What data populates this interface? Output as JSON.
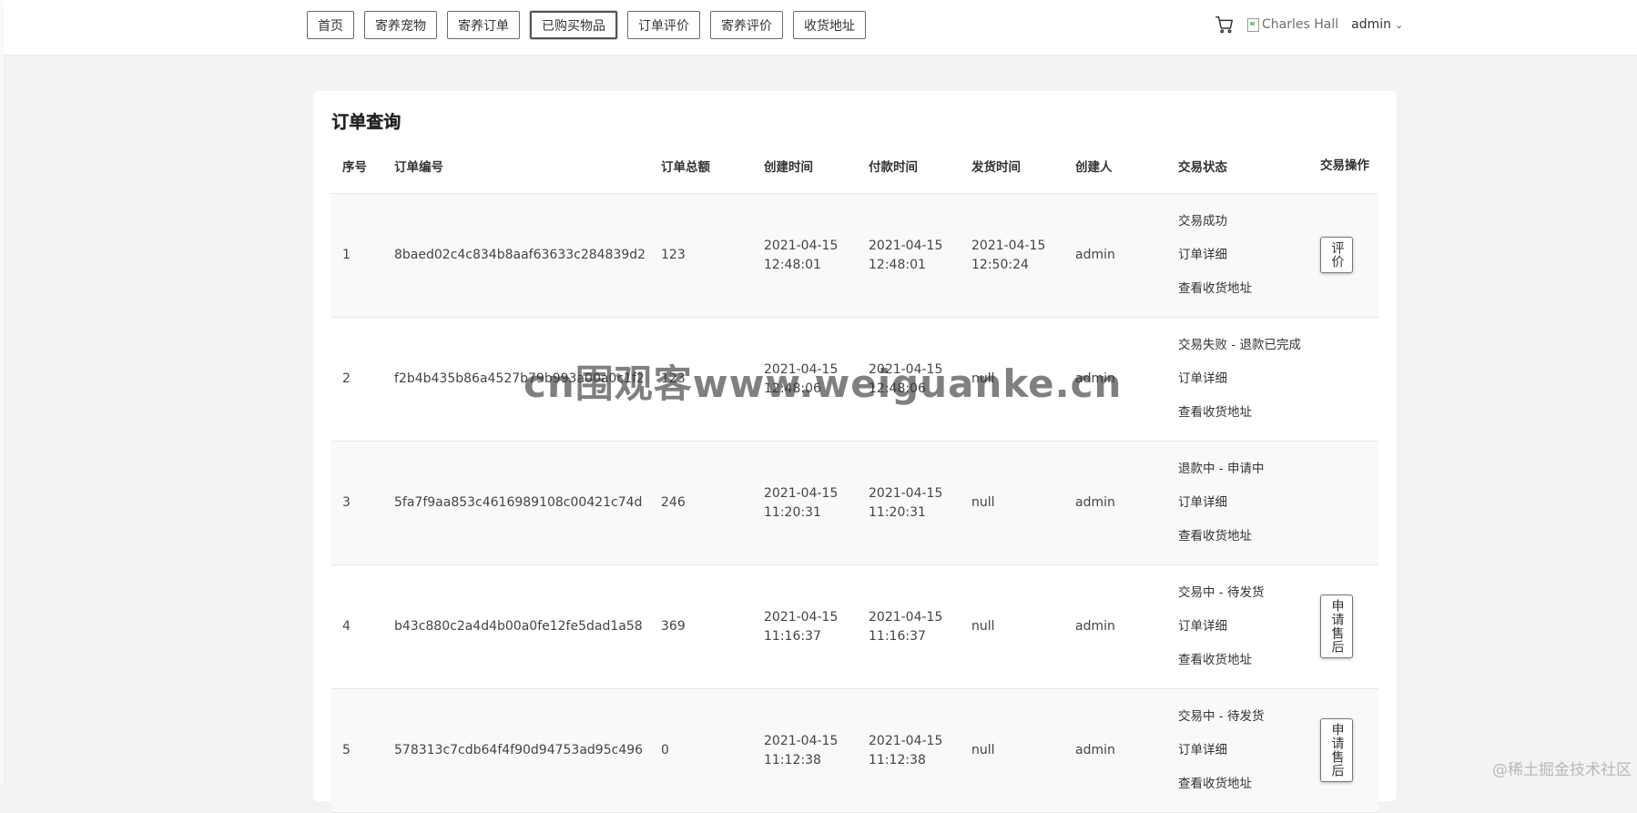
{
  "nav": {
    "items": [
      "首页",
      "寄养宠物",
      "寄养订单",
      "已购买物品",
      "订单评价",
      "寄养评价",
      "收货地址"
    ],
    "active_index": 3
  },
  "header": {
    "cart_icon": "cart-icon",
    "avatar_alt": "Charles Hall",
    "username": "admin",
    "dropdown_icon": "chevron-down-icon"
  },
  "card": {
    "title": "订单查询"
  },
  "table": {
    "headers": [
      "序号",
      "订单编号",
      "订单总额",
      "创建时间",
      "付款时间",
      "发货时间",
      "创建人",
      "交易状态",
      "交易操作"
    ],
    "rows": [
      {
        "no": "1",
        "order_id": "8baed02c4c834b8aaf63633c284839d2",
        "total": "123",
        "created": "2021-04-15 12:48:01",
        "paid": "2021-04-15 12:48:01",
        "shipped": "2021-04-15 12:50:24",
        "creator": "admin",
        "status": "交易成功",
        "detail": "订单详细",
        "address": "查看收货地址",
        "action": "评价"
      },
      {
        "no": "2",
        "order_id": "f2b4b435b86a4527b79b993a00a0c1f2",
        "total": "123",
        "created": "2021-04-15 12:48:06",
        "paid": "2021-04-15 12:48:06",
        "shipped": "null",
        "creator": "admin",
        "status": "交易失败 - 退款已完成",
        "detail": "订单详细",
        "address": "查看收货地址",
        "action": ""
      },
      {
        "no": "3",
        "order_id": "5fa7f9aa853c4616989108c00421c74d",
        "total": "246",
        "created": "2021-04-15 11:20:31",
        "paid": "2021-04-15 11:20:31",
        "shipped": "null",
        "creator": "admin",
        "status": "退款中 - 申请中",
        "detail": "订单详细",
        "address": "查看收货地址",
        "action": ""
      },
      {
        "no": "4",
        "order_id": "b43c880c2a4d4b00a0fe12fe5dad1a58",
        "total": "369",
        "created": "2021-04-15 11:16:37",
        "paid": "2021-04-15 11:16:37",
        "shipped": "null",
        "creator": "admin",
        "status": "交易中 - 待发货",
        "detail": "订单详细",
        "address": "查看收货地址",
        "action": "申请售后"
      },
      {
        "no": "5",
        "order_id": "578313c7cdb64f4f90d94753ad95c496",
        "total": "0",
        "created": "2021-04-15 11:12:38",
        "paid": "2021-04-15 11:12:38",
        "shipped": "null",
        "creator": "admin",
        "status": "交易中 - 待发货",
        "detail": "订单详细",
        "address": "查看收货地址",
        "action": "申请售后"
      }
    ]
  },
  "overlay": {
    "watermark": "cn围观客www.weiguanke.cn",
    "corner": "@稀土掘金技术社区"
  }
}
